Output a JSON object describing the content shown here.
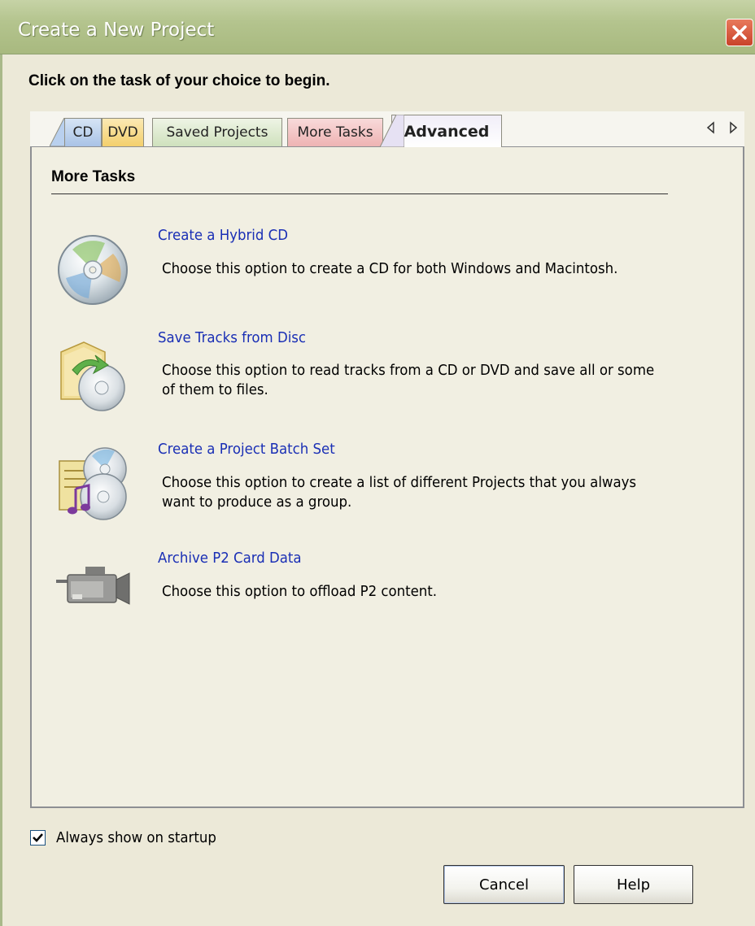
{
  "window": {
    "title": "Create a New Project"
  },
  "instruction": "Click on the task of your choice to begin.",
  "tabs": [
    {
      "label": "CD",
      "color": "#a9c3e6"
    },
    {
      "label": "DVD",
      "color": "#f3cf6c"
    },
    {
      "label": "Saved Projects",
      "color": "#cfe1bd"
    },
    {
      "label": "More Tasks",
      "color": "#eeb3b3"
    },
    {
      "label": "Advanced",
      "color": "#f1eef8",
      "selected": true
    }
  ],
  "panel": {
    "section_title": "More Tasks",
    "tasks": [
      {
        "title": "Create a Hybrid CD",
        "description": "Choose this option to create a CD for both Windows and Macintosh.",
        "icon": "hybrid-cd-icon"
      },
      {
        "title": "Save Tracks from Disc",
        "description": "Choose this option to read tracks from a CD or DVD and save all or some of them to files.",
        "icon": "save-tracks-icon"
      },
      {
        "title": "Create a Project Batch Set",
        "description": "Choose this option to create a list of different Projects that you always want to produce as a group.",
        "icon": "batch-set-icon"
      },
      {
        "title": "Archive P2 Card Data",
        "description": "Choose this option to offload P2 content.",
        "icon": "camcorder-icon"
      }
    ]
  },
  "footer": {
    "always_show_label": "Always show on startup",
    "always_show_checked": true,
    "cancel_label": "Cancel",
    "help_label": "Help"
  },
  "colors": {
    "link": "#1a2fb5",
    "window_bg": "#ece9d8",
    "titlebar": "#b4c48e",
    "close_button": "#c9432a"
  }
}
